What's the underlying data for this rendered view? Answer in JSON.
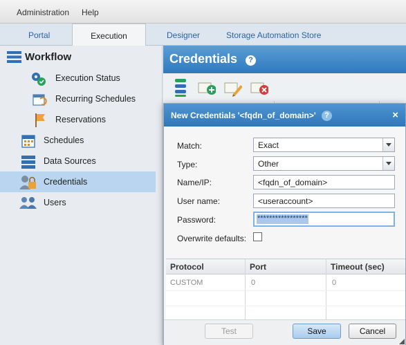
{
  "menu": {
    "administration": "Administration",
    "help": "Help"
  },
  "tabs": {
    "portal": "Portal",
    "execution": "Execution",
    "designer": "Designer",
    "storage_store": "Storage Automation Store"
  },
  "sidebar": {
    "heading": "Workflow",
    "items": {
      "execution_status": "Execution Status",
      "recurring_schedules": "Recurring Schedules",
      "reservations": "Reservations",
      "schedules": "Schedules",
      "data_sources": "Data Sources",
      "credentials": "Credentials",
      "users": "Users"
    }
  },
  "content": {
    "title": "Credentials",
    "help": "?"
  },
  "dialog": {
    "title": "New Credentials '<fqdn_of_domain>'",
    "help": "?",
    "close": "×",
    "fields": {
      "match_label": "Match:",
      "match_value": "Exact",
      "type_label": "Type:",
      "type_value": "Other",
      "name_label": "Name/IP:",
      "name_value": "<fqdn_of_domain>",
      "user_label": "User name:",
      "user_value": "<useraccount>",
      "password_label": "Password:",
      "password_value": "*****************",
      "overwrite_label": "Overwrite defaults:"
    },
    "grid": {
      "headers": {
        "protocol": "Protocol",
        "port": "Port",
        "timeout": "Timeout (sec)"
      },
      "row": {
        "protocol": "CUSTOM",
        "port": "0",
        "timeout": "0"
      }
    },
    "buttons": {
      "test": "Test",
      "save": "Save",
      "cancel": "Cancel"
    }
  }
}
